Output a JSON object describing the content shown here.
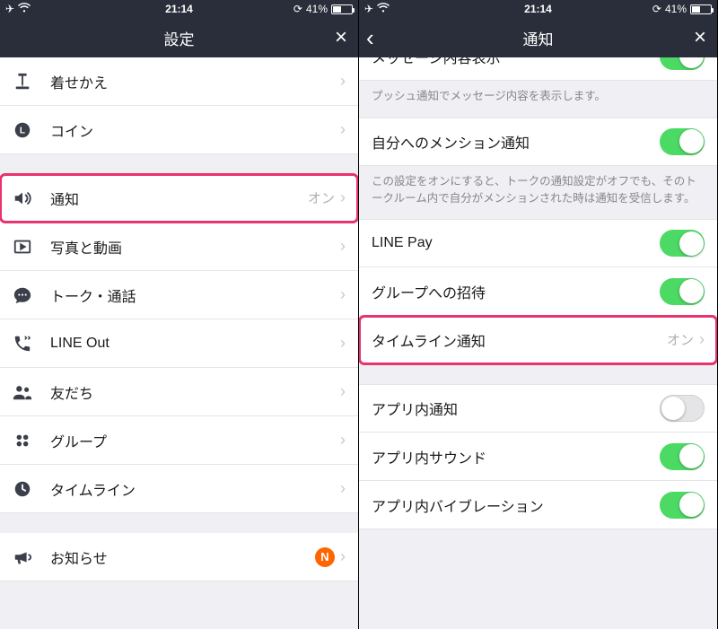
{
  "status": {
    "time": "21:14",
    "battery_text": "41%"
  },
  "left": {
    "title": "設定",
    "rows": [
      {
        "id": "theme",
        "icon": "brush",
        "label": "着せかえ"
      },
      {
        "id": "coin",
        "icon": "coin",
        "label": "コイン"
      }
    ],
    "rows2": [
      {
        "id": "notif",
        "icon": "speaker",
        "label": "通知",
        "value": "オン",
        "highlight": true
      },
      {
        "id": "photo",
        "icon": "playbox",
        "label": "写真と動画"
      },
      {
        "id": "talk",
        "icon": "chat",
        "label": "トーク・通話"
      },
      {
        "id": "lineout",
        "icon": "phone",
        "label": "LINE Out"
      },
      {
        "id": "friends",
        "icon": "people",
        "label": "友だち"
      },
      {
        "id": "group",
        "icon": "dots4",
        "label": "グループ"
      },
      {
        "id": "timeline",
        "icon": "clock",
        "label": "タイムライン"
      }
    ],
    "rows3": [
      {
        "id": "news",
        "icon": "megaphone",
        "label": "お知らせ",
        "badge": "N"
      }
    ]
  },
  "right": {
    "title": "通知",
    "rowA_label": "メッセージ内容表示",
    "rowA_desc": "プッシュ通知でメッセージ内容を表示します。",
    "rowB_label": "自分へのメンション通知",
    "rowB_desc": "この設定をオンにすると、トークの通知設定がオフでも、そのトークルーム内で自分がメンションされた時は通知を受信します。",
    "rowC_label": "LINE Pay",
    "rowD_label": "グループへの招待",
    "rowE_label": "タイムライン通知",
    "rowE_value": "オン",
    "rowF_label": "アプリ内通知",
    "rowG_label": "アプリ内サウンド",
    "rowH_label": "アプリ内バイブレーション"
  }
}
